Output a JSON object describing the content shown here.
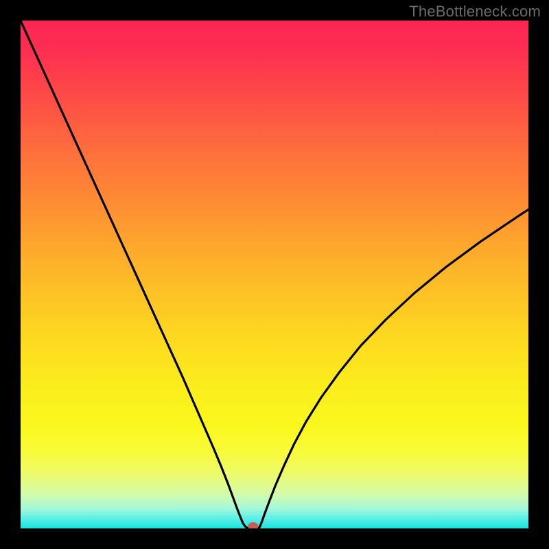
{
  "watermark": "TheBottleneck.com",
  "colors": {
    "frame_bg": "#000000",
    "marker": "#c95c53",
    "curve": "#000000"
  },
  "chart_data": {
    "type": "line",
    "title": "",
    "xlabel": "",
    "ylabel": "",
    "xlim": [
      0,
      100
    ],
    "ylim": [
      0,
      100
    ],
    "x": [
      0,
      2,
      5,
      8,
      11,
      14,
      17,
      20,
      23,
      26,
      29,
      32,
      34,
      36,
      38,
      39.5,
      40.8,
      41.8,
      42.6,
      43.3,
      43.8,
      44.3,
      44.8,
      45.2,
      45.3,
      46.8,
      47.1,
      47.5,
      48.1,
      49.0,
      50.2,
      51.8,
      53.8,
      56.2,
      59.2,
      62.8,
      67.0,
      72.0,
      77.5,
      83.8,
      90.6,
      98.0,
      100.0
    ],
    "y": [
      100,
      95.6,
      89.0,
      82.4,
      75.8,
      69.2,
      62.6,
      56.0,
      49.4,
      42.8,
      36.2,
      29.6,
      25.0,
      20.4,
      15.8,
      12.2,
      8.9,
      6.2,
      4.0,
      2.2,
      1.0,
      0.3,
      0.02,
      0.0,
      0.0,
      0.0,
      0.3,
      1.3,
      3.0,
      5.4,
      8.5,
      12.2,
      16.5,
      21.0,
      25.8,
      30.8,
      36.0,
      41.2,
      46.3,
      51.5,
      56.5,
      61.5,
      62.8
    ],
    "marker_point": {
      "x": 45.8,
      "y": 0.0
    },
    "annotations": []
  }
}
